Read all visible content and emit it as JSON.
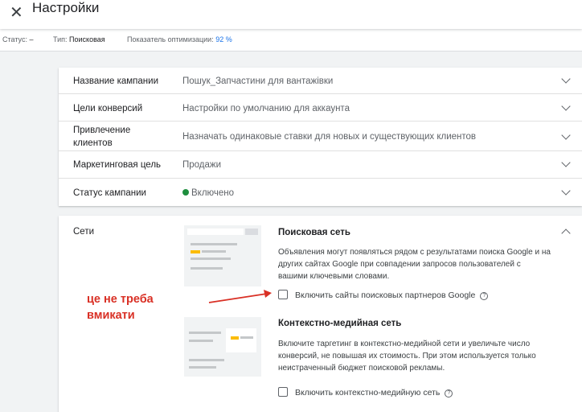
{
  "header": {
    "title": "Настройки",
    "close_icon": "close-icon"
  },
  "status_bar": {
    "status_label": "Статус:",
    "status_value": "–",
    "type_label": "Тип:",
    "type_value": "Поисковая",
    "optimization_label": "Показатель оптимизации:",
    "optimization_value": "92 %"
  },
  "settings": [
    {
      "label": "Название кампании",
      "value": "Пошук_Запчастини для вантажівки"
    },
    {
      "label": "Цели конверсий",
      "value": "Настройки по умолчанию для аккаунта"
    },
    {
      "label": "Привлечение клиентов",
      "value": "Назначать одинаковые ставки для новых и существующих клиентов"
    },
    {
      "label": "Маркетинговая цель",
      "value": "Продажи"
    },
    {
      "label": "Статус кампании",
      "value": "Включено"
    }
  ],
  "colors": {
    "accent": "#1a73e8",
    "status_green": "#1e8e3e",
    "annotation_red": "#d93025"
  },
  "networks": {
    "label": "Сети",
    "search": {
      "title": "Поисковая сеть",
      "description": "Объявления могут появляться рядом с результатами поиска Google и на других сайтах Google при совпадении запросов пользователей с вашими ключевыми словами.",
      "checkbox_label": "Включить сайты поисковых партнеров Google"
    },
    "display": {
      "title": "Контекстно-медийная сеть",
      "description": "Включите таргетинг в контекстно-медийной сети и увеличьте число конверсий, не повышая их стоимость. При этом используется только неистраченный бюджет поисковой рекламы.",
      "checkbox_label": "Включить контекстно-медийную сеть"
    }
  },
  "annotation": {
    "line1": "це не треба",
    "line2": "вмикати"
  }
}
